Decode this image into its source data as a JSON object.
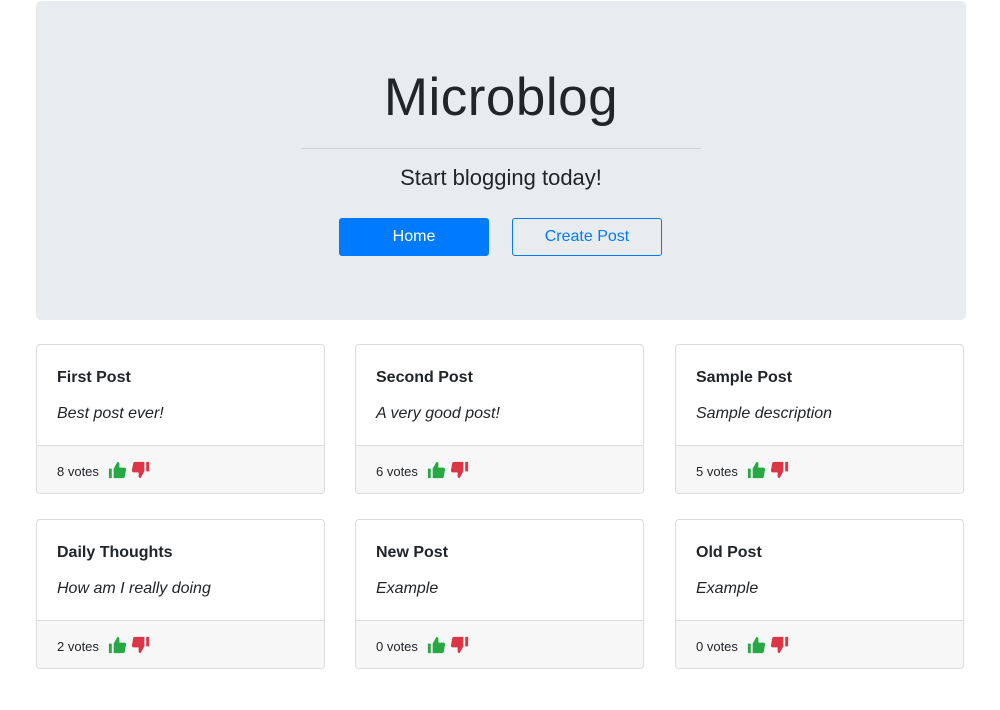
{
  "header": {
    "title": "Microblog",
    "subtitle": "Start blogging today!",
    "home_label": "Home",
    "create_label": "Create Post"
  },
  "colors": {
    "primary": "#007bff",
    "upvote": "#28a745",
    "downvote": "#dc3545",
    "jumbotron_bg": "#e9ecef"
  },
  "icons": {
    "upvote": "thumbs-up-icon",
    "downvote": "thumbs-down-icon"
  },
  "posts": [
    {
      "title": "First Post",
      "description": "Best post ever!",
      "votes": "8 votes"
    },
    {
      "title": "Second Post",
      "description": "A very good post!",
      "votes": "6 votes"
    },
    {
      "title": "Sample Post",
      "description": "Sample description",
      "votes": "5 votes"
    },
    {
      "title": "Daily Thoughts",
      "description": "How am I really doing",
      "votes": "2 votes"
    },
    {
      "title": "New Post",
      "description": "Example",
      "votes": "0 votes"
    },
    {
      "title": "Old Post",
      "description": "Example",
      "votes": "0 votes"
    }
  ]
}
